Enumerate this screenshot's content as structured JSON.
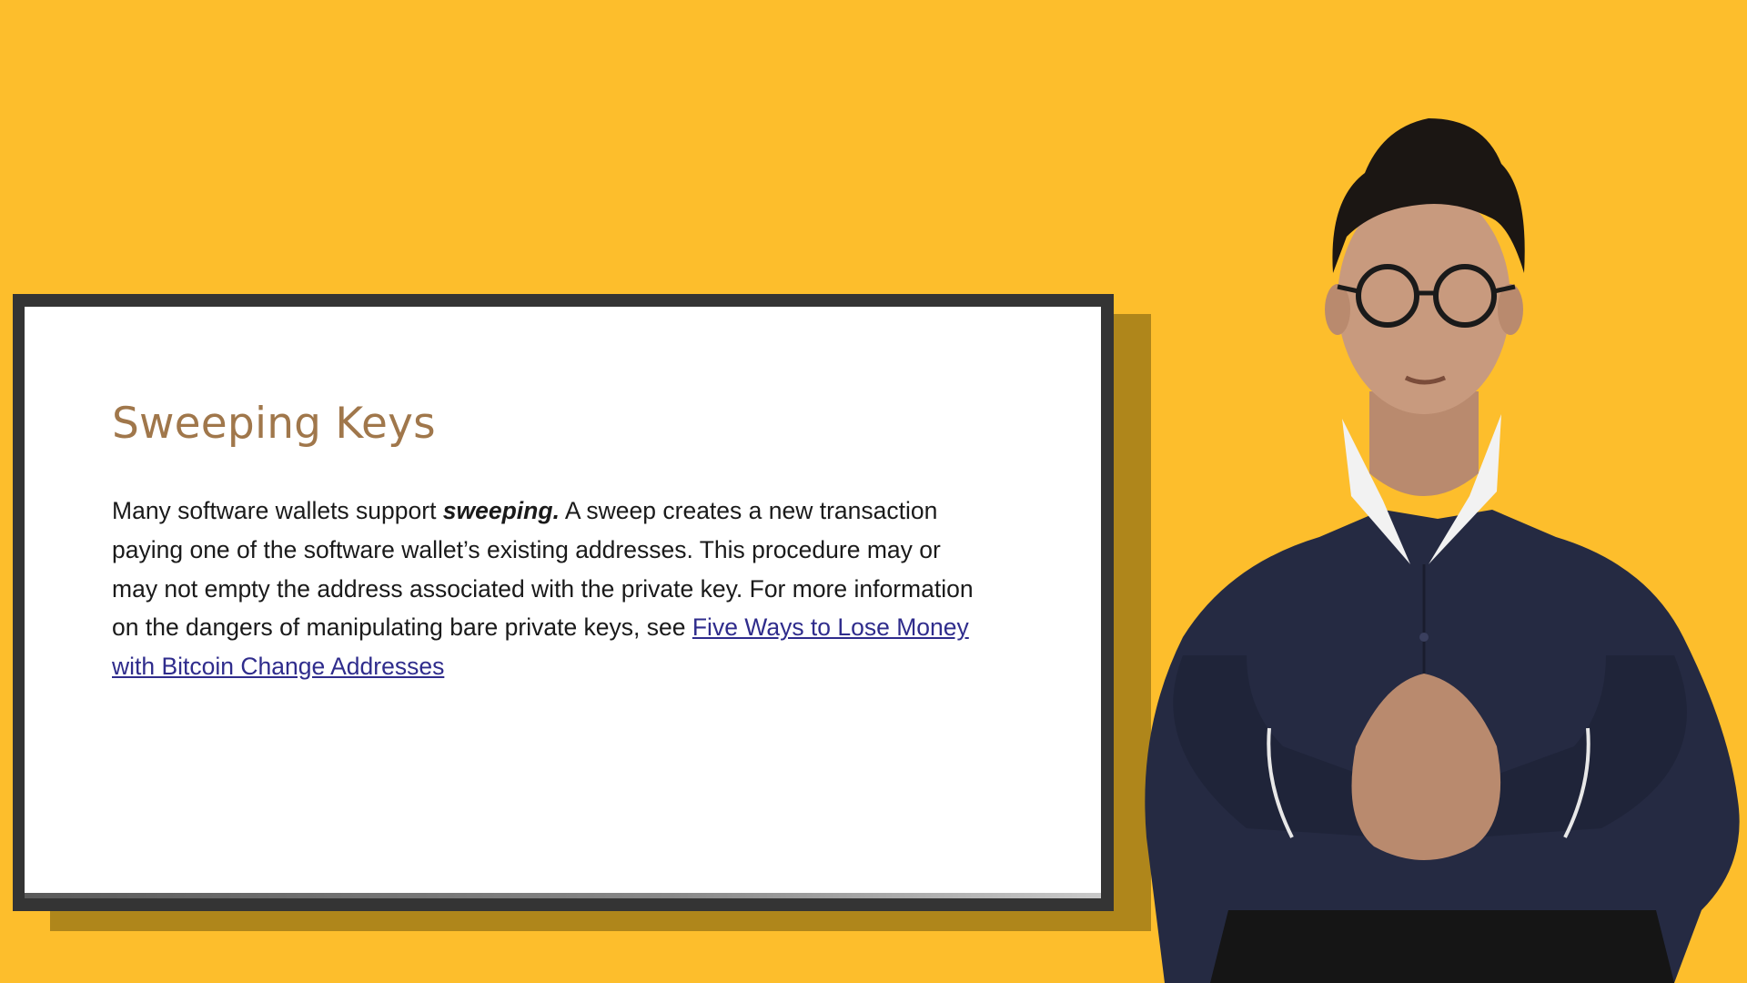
{
  "slide": {
    "title": "Sweeping Keys",
    "body_part1": "Many software wallets support ",
    "body_emphasis": "sweeping",
    "body_emphasis_punct": ".",
    "body_part2": " A sweep creates a new transaction paying one of the software wallet’s existing addresses. This procedure may or may not empty the address associated with the private key. For more information on the dangers of manipulating bare private keys, see ",
    "link_text": "Five Ways to Lose Money with Bitcoin Change Addresses"
  },
  "colors": {
    "background": "#FDBE2C",
    "title": "#A0774B",
    "link": "#2F2C8C",
    "frame": "#343434"
  },
  "presenter": {
    "description_icon": "person-presenter"
  }
}
